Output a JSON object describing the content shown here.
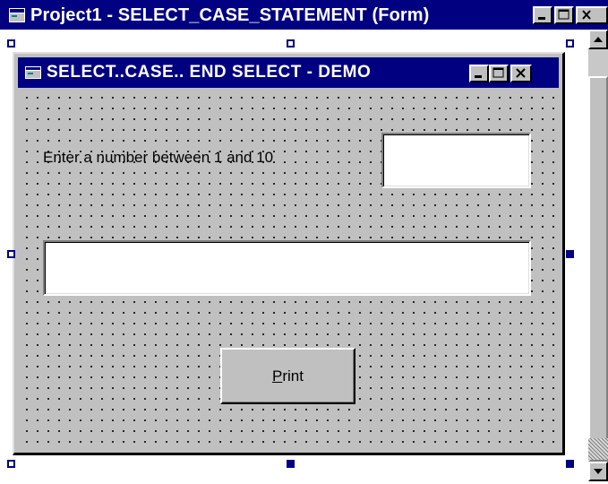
{
  "outer_window": {
    "title": "Project1 - SELECT_CASE_STATEMENT (Form)",
    "icon": "vb-form-icon",
    "controls": [
      "minimize-icon",
      "maximize-icon",
      "close-icon"
    ]
  },
  "form_window": {
    "title": "SELECT..CASE.. END SELECT - DEMO",
    "icon": "vb-form-icon",
    "controls": [
      "minimize-icon",
      "maximize-icon",
      "close-icon"
    ]
  },
  "form": {
    "prompt_label": "Enter a number between 1 and 10",
    "number_input_value": "",
    "result_textbox_value": "",
    "print_button": {
      "access_key": "P",
      "rest": "rint"
    }
  },
  "colors": {
    "titlebar": "#000080",
    "face": "#c0c0c0",
    "handle": "#000080",
    "grid_dot": "#000000"
  }
}
